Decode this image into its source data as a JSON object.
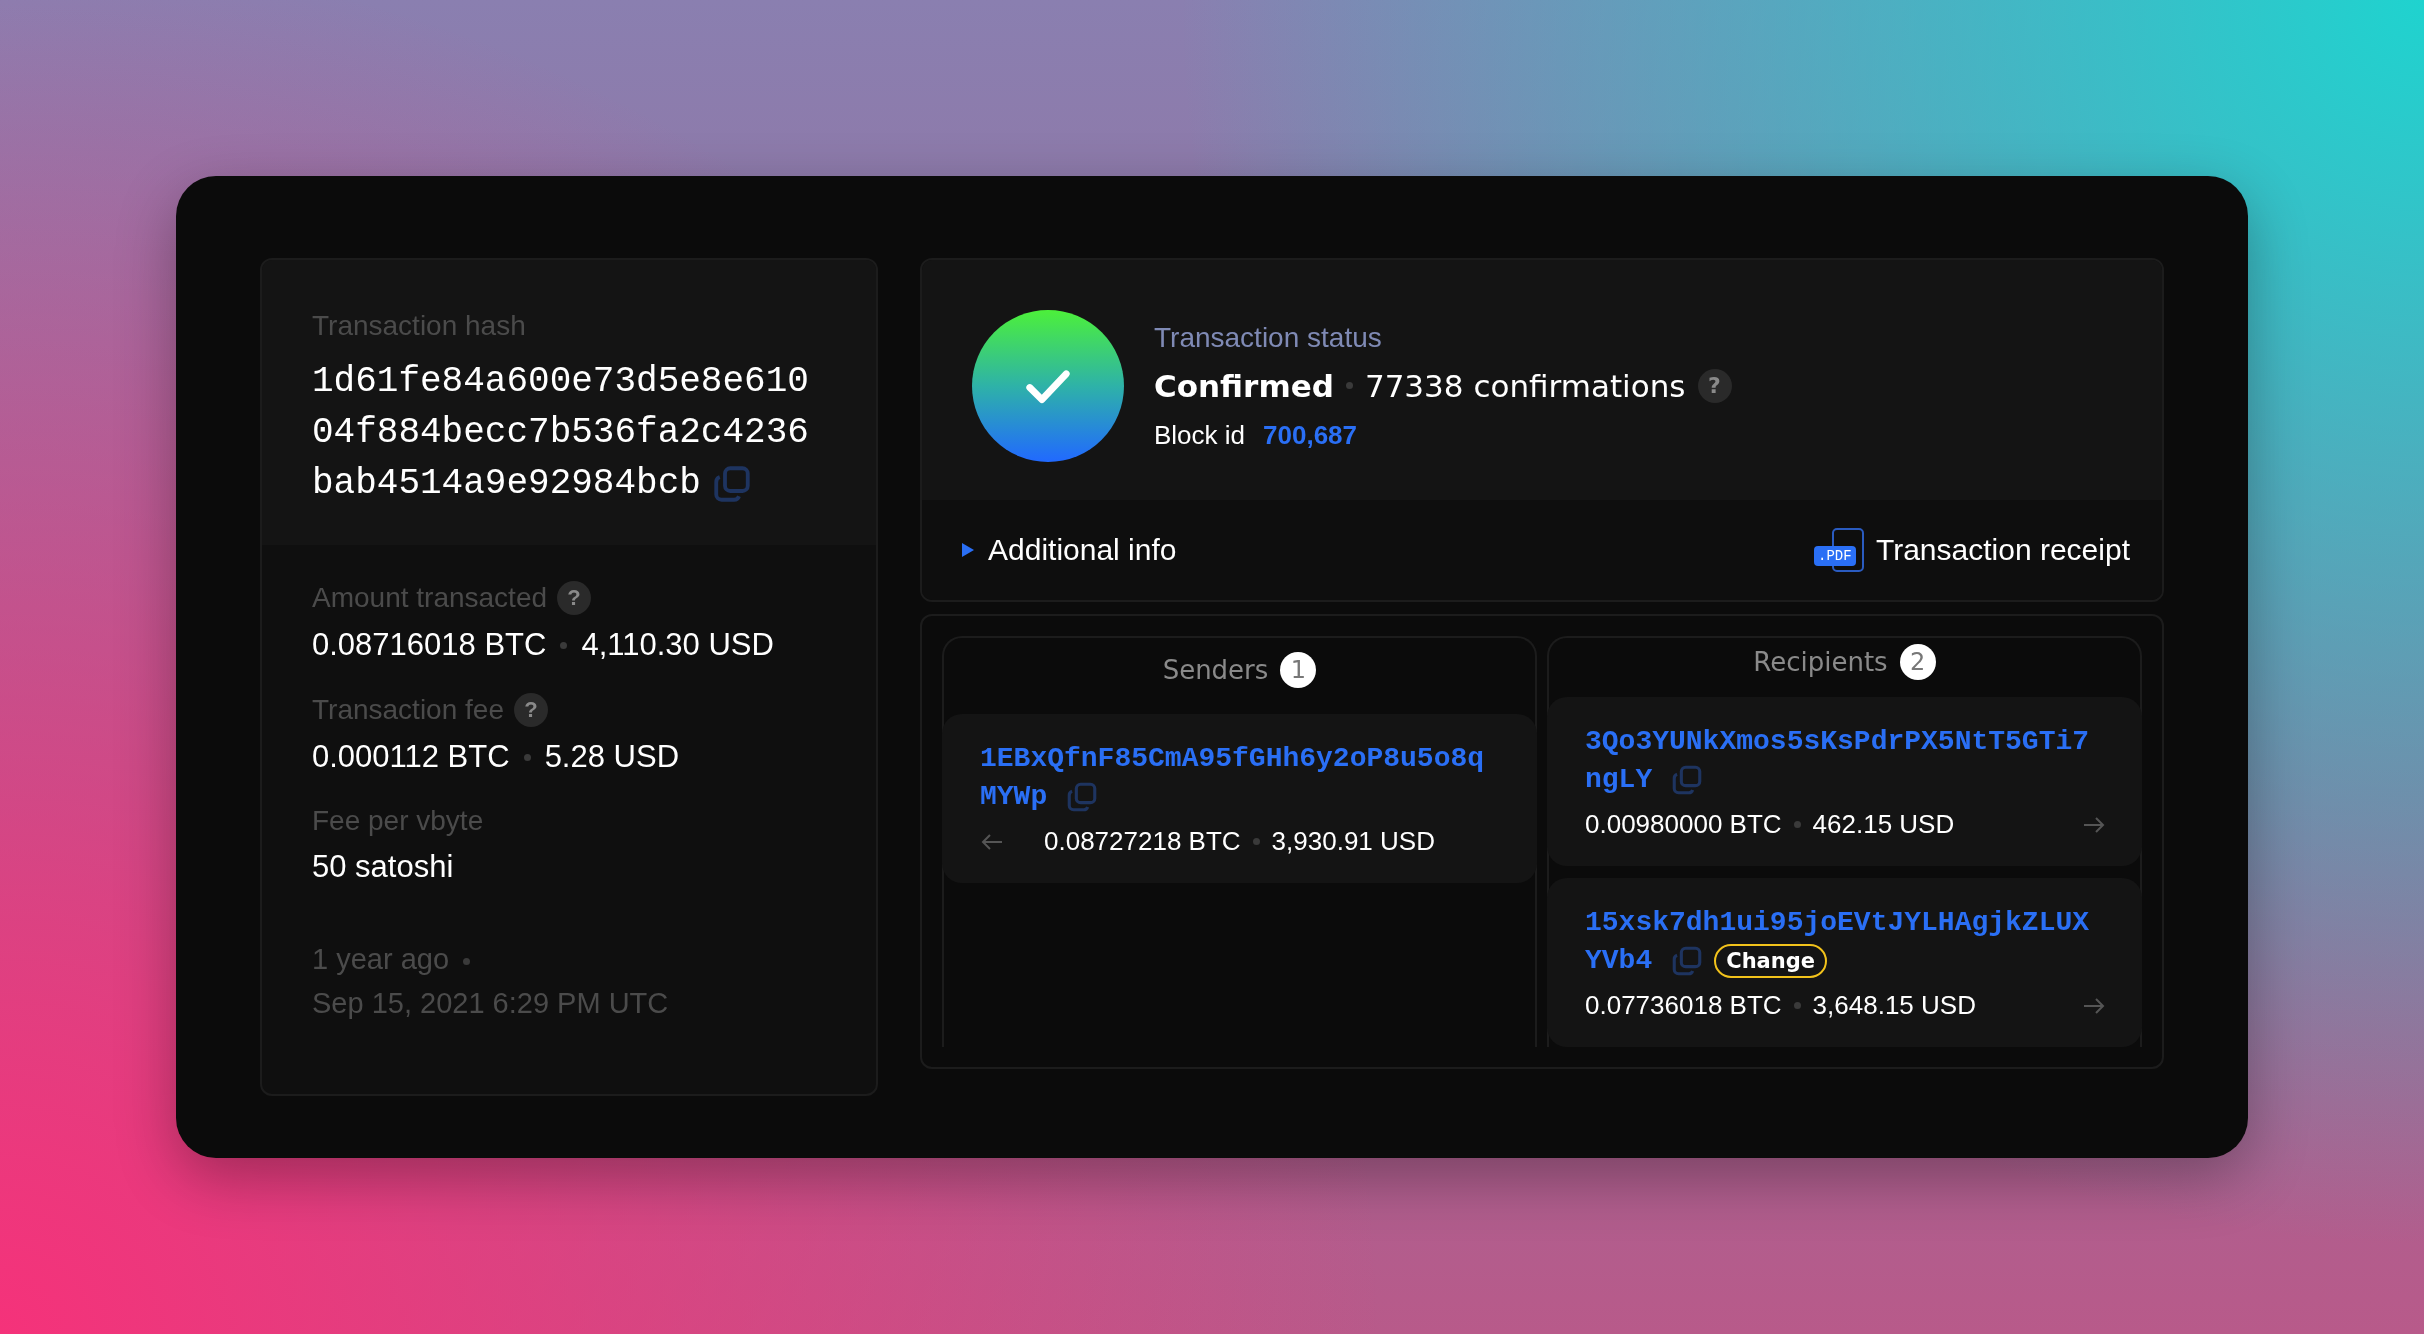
{
  "hash_panel": {
    "label": "Transaction hash",
    "hash_lines": [
      "1d61fe84a600e73d5e8e610",
      "04f884becc7b536fa2c4236",
      "bab4514a9e92984bcb"
    ]
  },
  "details": [
    {
      "label": "Amount transacted",
      "help": "?",
      "btc": "0.08716018 BTC",
      "usd": "4,110.30 USD"
    },
    {
      "label": "Transaction fee",
      "help": "?",
      "btc": "0.000112 BTC",
      "usd": "5.28 USD"
    },
    {
      "label": "Fee per vbyte",
      "value": "50 satoshi"
    }
  ],
  "timestamp": {
    "relative": "1 year ago",
    "date": "Sep 15, 2021 6:29 PM UTC"
  },
  "status": {
    "label": "Transaction status",
    "state": "Confirmed",
    "confirmations": "77338 confirmations",
    "help": "?",
    "block_label": "Block id",
    "block_id": "700,687"
  },
  "additional_info": {
    "label": "Additional info",
    "expanded": false
  },
  "receipt": {
    "badge": ".PDF",
    "label": "Transaction receipt"
  },
  "senders": {
    "title": "Senders",
    "count": "1",
    "items": [
      {
        "address_lines": [
          "1EBxQfnF85CmA95fGHh6y2oP8u5o8q",
          "MYWp"
        ],
        "btc": "0.08727218 BTC",
        "usd": "3,930.91 USD",
        "change": false
      }
    ]
  },
  "recipients": {
    "title": "Recipients",
    "count": "2",
    "items": [
      {
        "address_lines": [
          "3Qo3YUNkXmos5sKsPdrPX5NtT5GTi7",
          "ngLY"
        ],
        "btc": "0.00980000 BTC",
        "usd": "462.15 USD",
        "change": false
      },
      {
        "address_lines": [
          "15xsk7dh1ui95joEVtJYLHAgjkZLUX",
          "YVb4"
        ],
        "btc": "0.07736018 BTC",
        "usd": "3,648.15 USD",
        "change": true,
        "change_label": "Change"
      }
    ]
  }
}
